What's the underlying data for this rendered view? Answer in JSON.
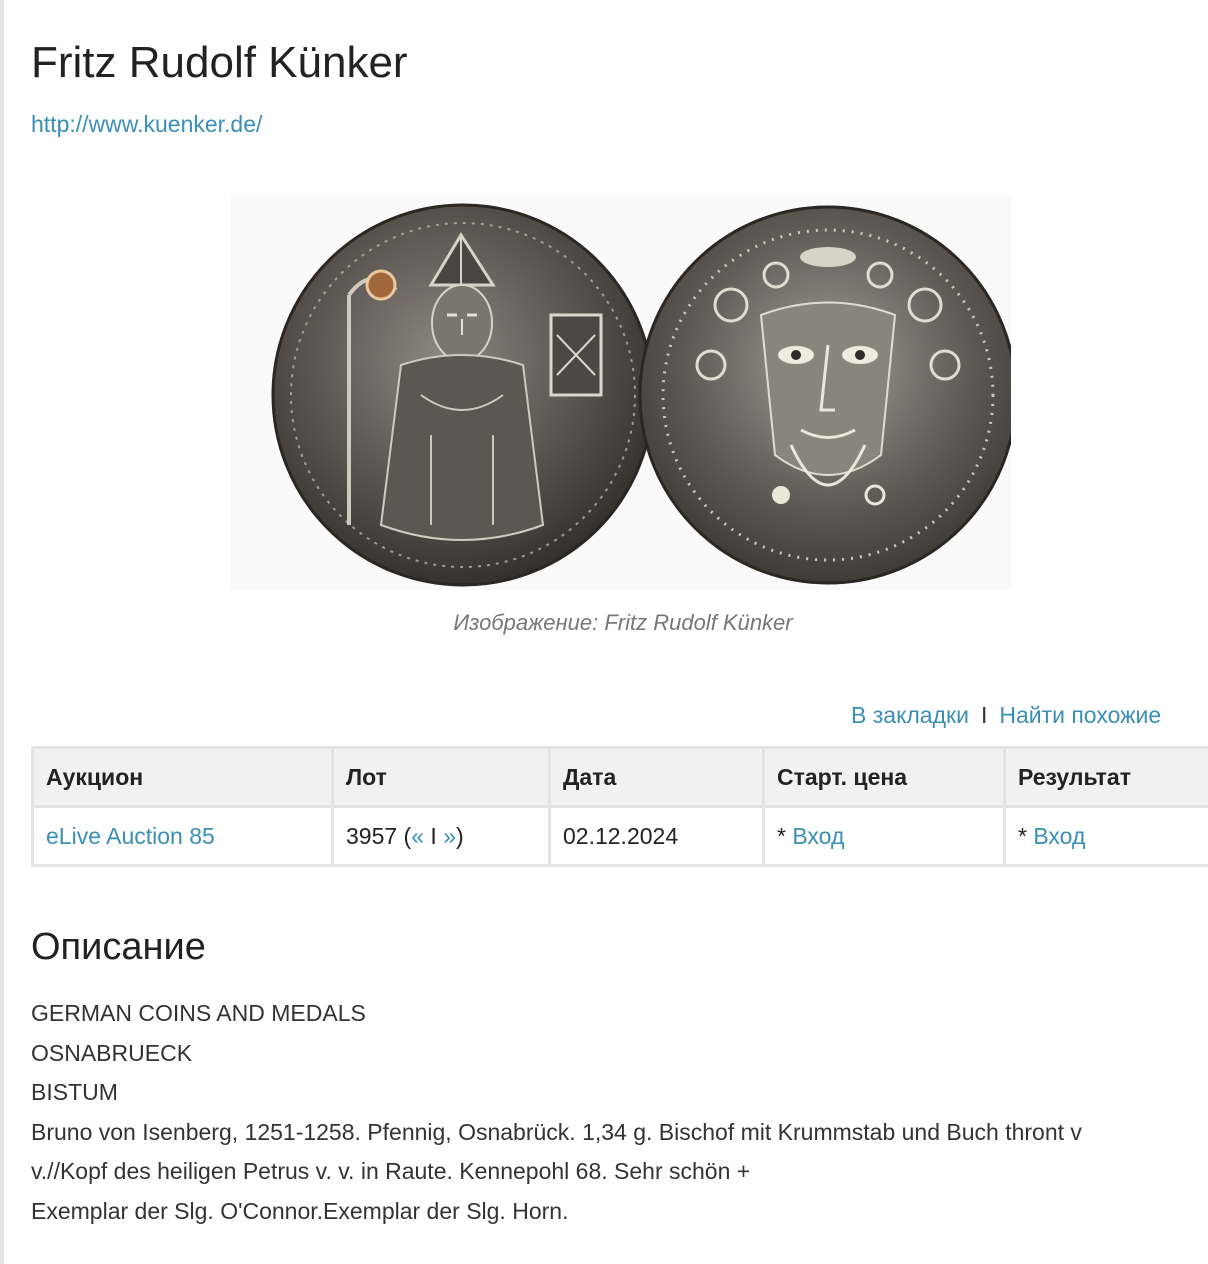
{
  "header": {
    "title": "Fritz Rudolf Künker",
    "website": "http://www.kuenker.de/"
  },
  "image": {
    "caption": "Изображение: Fritz Rudolf Künker",
    "obverse_icon": "coin-obverse-bishop-icon",
    "reverse_icon": "coin-reverse-head-icon"
  },
  "actions": {
    "bookmark": "В закладки",
    "separator": "I",
    "find_similar": "Найти похожие"
  },
  "lot_table": {
    "headers": {
      "auction": "Аукцион",
      "lot": "Лот",
      "date": "Дата",
      "start_price": "Старт. цена",
      "result": "Результат"
    },
    "row": {
      "auction": "eLive Auction 85",
      "lot_number": "3957",
      "lot_prev": "«",
      "lot_sep": "I",
      "lot_next": "»",
      "date": "02.12.2024",
      "start_price_prefix": "*",
      "start_price_link": "Вход",
      "result_prefix": "*",
      "result_link": "Вход"
    }
  },
  "description": {
    "heading": "Описание",
    "lines": [
      "GERMAN COINS AND MEDALS",
      "OSNABRUECK",
      "BISTUM",
      "Bruno von Isenberg, 1251-1258. Pfennig, Osnabrück. 1,34 g. Bischof mit Krummstab und Buch thront v",
      "v.//Kopf des heiligen Petrus v. v. in Raute. Kennepohl 68. Sehr schön +",
      "Exemplar der Slg. O'Connor.Exemplar der Slg. Horn."
    ]
  },
  "colors": {
    "link": "#3a8fb7",
    "table_header_bg": "#f1f1f1",
    "table_border": "#e4e4e4",
    "caption": "#777777"
  }
}
